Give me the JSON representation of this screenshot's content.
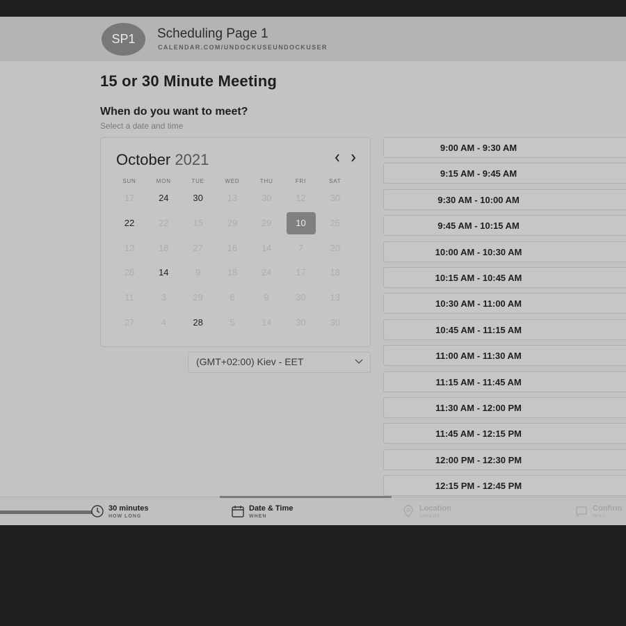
{
  "header": {
    "avatar_initials": "SP1",
    "page_name": "Scheduling Page 1",
    "page_url": "CALENDAR.COM/UNDOCKUSEUNDOCKUSER"
  },
  "meeting": {
    "title": "15 or 30 Minute Meeting",
    "question": "When do you want to meet?",
    "question_sub": "Select a date and time"
  },
  "calendar": {
    "month": "October",
    "year": "2021",
    "prev_icon": "chevron-left-icon",
    "next_icon": "chevron-right-icon",
    "days_of_week": [
      "SUN",
      "MON",
      "TUE",
      "WED",
      "THU",
      "FRI",
      "SAT"
    ],
    "weeks": [
      [
        {
          "d": "17",
          "a": false
        },
        {
          "d": "24",
          "a": true
        },
        {
          "d": "30",
          "a": true
        },
        {
          "d": "13",
          "a": false
        },
        {
          "d": "30",
          "a": false
        },
        {
          "d": "12",
          "a": false
        },
        {
          "d": "30",
          "a": false
        }
      ],
      [
        {
          "d": "22",
          "a": true
        },
        {
          "d": "22",
          "a": false
        },
        {
          "d": "15",
          "a": false
        },
        {
          "d": "29",
          "a": false
        },
        {
          "d": "29",
          "a": false
        },
        {
          "d": "10",
          "a": true,
          "selected": true
        },
        {
          "d": "25",
          "a": false
        }
      ],
      [
        {
          "d": "13",
          "a": false
        },
        {
          "d": "18",
          "a": false
        },
        {
          "d": "27",
          "a": false
        },
        {
          "d": "16",
          "a": false
        },
        {
          "d": "14",
          "a": false
        },
        {
          "d": "7",
          "a": false
        },
        {
          "d": "20",
          "a": false
        }
      ],
      [
        {
          "d": "28",
          "a": false
        },
        {
          "d": "14",
          "a": true
        },
        {
          "d": "9",
          "a": false
        },
        {
          "d": "18",
          "a": false
        },
        {
          "d": "24",
          "a": false
        },
        {
          "d": "17",
          "a": false
        },
        {
          "d": "18",
          "a": false
        }
      ],
      [
        {
          "d": "11",
          "a": false
        },
        {
          "d": "3",
          "a": false
        },
        {
          "d": "29",
          "a": false
        },
        {
          "d": "6",
          "a": false
        },
        {
          "d": "9",
          "a": false
        },
        {
          "d": "30",
          "a": false
        },
        {
          "d": "13",
          "a": false
        }
      ],
      [
        {
          "d": "27",
          "a": false
        },
        {
          "d": "4",
          "a": false
        },
        {
          "d": "28",
          "a": true
        },
        {
          "d": "5",
          "a": false
        },
        {
          "d": "14",
          "a": false
        },
        {
          "d": "30",
          "a": false
        },
        {
          "d": "30",
          "a": false
        }
      ]
    ]
  },
  "timezone": {
    "value": "(GMT+02:00) Kiev - EET",
    "icon": "chevron-down-icon"
  },
  "time_slots": [
    "9:00 AM - 9:30 AM",
    "9:15 AM - 9:45 AM",
    "9:30 AM - 10:00 AM",
    "9:45 AM - 10:15 AM",
    "10:00 AM - 10:30 AM",
    "10:15 AM - 10:45 AM",
    "10:30 AM - 11:00 AM",
    "10:45 AM - 11:15 AM",
    "11:00 AM - 11:30 AM",
    "11:15 AM - 11:45 AM",
    "11:30 AM - 12:00 PM",
    "11:45 AM - 12:15 PM",
    "12:00 PM - 12:30 PM",
    "12:15 PM - 12:45 PM"
  ],
  "steps": [
    {
      "label": "30 minutes",
      "sub": "HOW LONG",
      "icon": "clock-icon",
      "state": "done"
    },
    {
      "label": "Date & Time",
      "sub": "WHEN",
      "icon": "calendar-icon",
      "state": "active"
    },
    {
      "label": "Location",
      "sub": "WHERE",
      "icon": "location-pin-icon",
      "state": "pending"
    },
    {
      "label": "Confirm",
      "sub": "WHO",
      "icon": "comment-icon",
      "state": "pending"
    }
  ],
  "colors": {
    "selected_day_bg": "#808080",
    "available_text": "#1e1e1e",
    "unavailable_text": "#aeaeae"
  }
}
